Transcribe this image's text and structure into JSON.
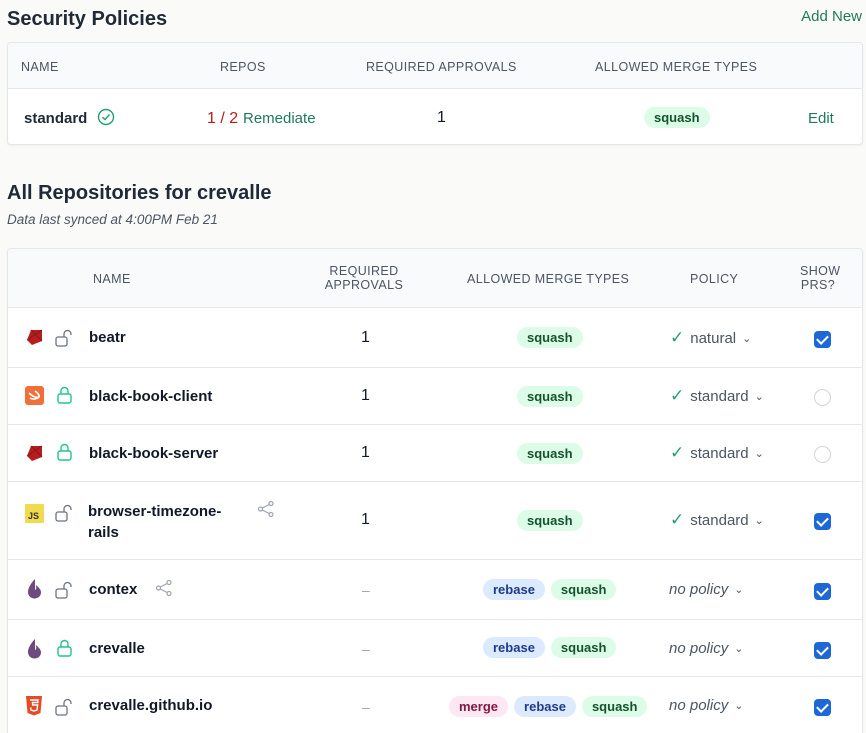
{
  "policies": {
    "title": "Security Policies",
    "add_new": "Add New",
    "headers": {
      "name": "NAME",
      "repos": "REPOS",
      "approvals": "REQUIRED APPROVALS",
      "merge": "ALLOWED MERGE TYPES"
    },
    "row": {
      "name": "standard",
      "repos_bad": "1 / 2",
      "remediate": "Remediate",
      "approvals": "1",
      "merge_types": [
        "squash"
      ],
      "edit": "Edit"
    }
  },
  "repos": {
    "title": "All Repositories for crevalle",
    "subtitle": "Data last synced at 4:00PM Feb 21",
    "headers": {
      "name": "NAME",
      "approvals_1": "REQUIRED",
      "approvals_2": "APPROVALS",
      "merge": "ALLOWED MERGE TYPES",
      "policy": "POLICY",
      "show_1": "SHOW",
      "show_2": "PRS?"
    },
    "rows": [
      {
        "name": "beatr",
        "lang": "ruby",
        "locked": false,
        "shared": false,
        "approvals": "1",
        "merge": [
          "squash"
        ],
        "policy": "natural",
        "policy_ok": true,
        "show": true
      },
      {
        "name": "black-book-client",
        "lang": "swift",
        "locked": true,
        "shared": false,
        "approvals": "1",
        "merge": [
          "squash"
        ],
        "policy": "standard",
        "policy_ok": true,
        "show": false
      },
      {
        "name": "black-book-server",
        "lang": "ruby",
        "locked": true,
        "shared": false,
        "approvals": "1",
        "merge": [
          "squash"
        ],
        "policy": "standard",
        "policy_ok": true,
        "show": false
      },
      {
        "name_1": "browser-timezone-",
        "name_2": "rails",
        "lang": "js",
        "locked": false,
        "shared": true,
        "approvals": "1",
        "merge": [
          "squash"
        ],
        "policy": "standard",
        "policy_ok": true,
        "show": true
      },
      {
        "name": "contex",
        "lang": "elixir",
        "locked": false,
        "shared": true,
        "approvals": "–",
        "merge": [
          "rebase",
          "squash"
        ],
        "policy": "no policy",
        "policy_ok": false,
        "show": true
      },
      {
        "name": "crevalle",
        "lang": "elixir",
        "locked": true,
        "shared": false,
        "approvals": "–",
        "merge": [
          "rebase",
          "squash"
        ],
        "policy": "no policy",
        "policy_ok": false,
        "show": true
      },
      {
        "name": "crevalle.github.io",
        "lang": "html5",
        "locked": false,
        "shared": false,
        "approvals": "–",
        "merge": [
          "merge",
          "rebase",
          "squash"
        ],
        "policy": "no policy",
        "policy_ok": false,
        "show": true
      }
    ]
  },
  "icons": {
    "check": "✓",
    "chevron": "⌄"
  },
  "colors": {
    "accent": "#1f7a5c",
    "danger": "#b91c1c",
    "checkbox": "#1d67d6"
  }
}
